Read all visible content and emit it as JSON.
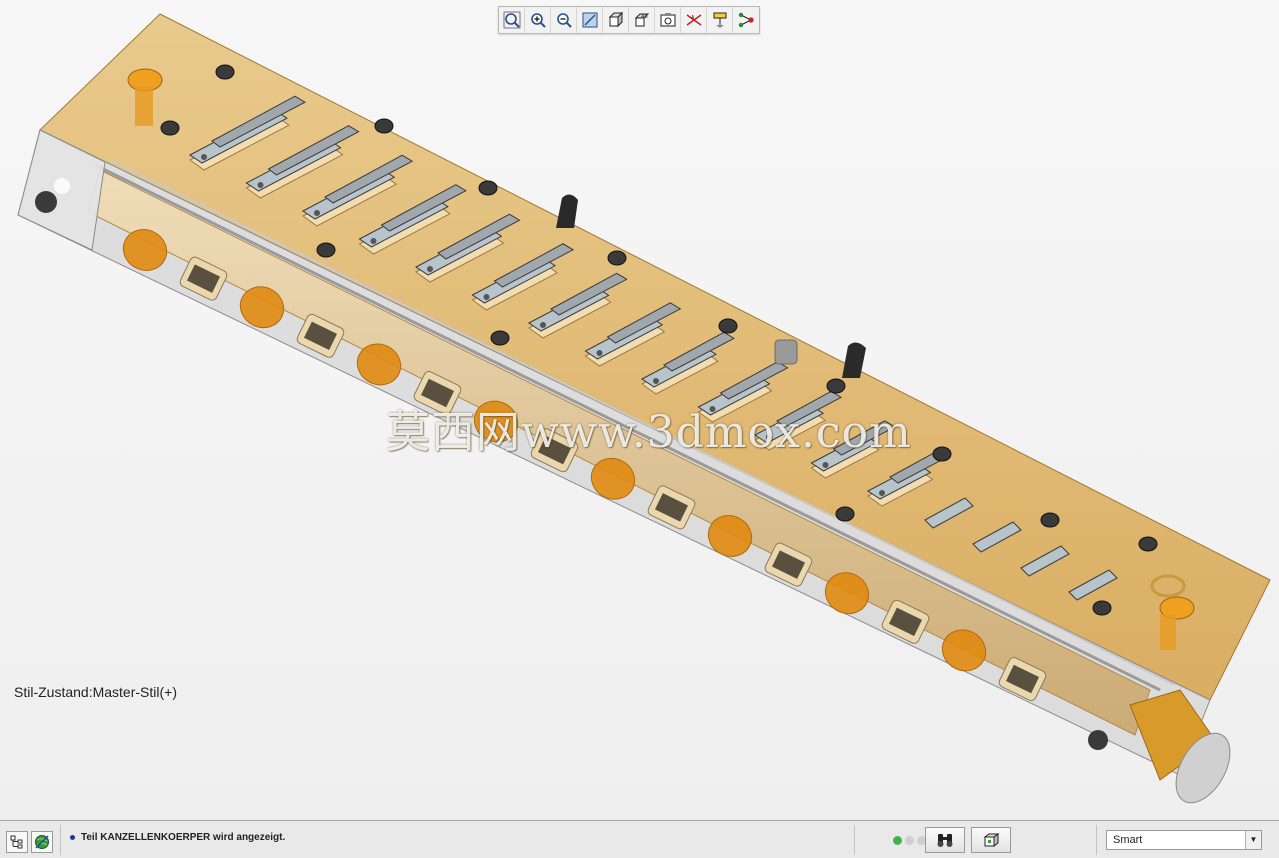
{
  "toolbar": {
    "buttons": [
      {
        "name": "zoom-fit-icon"
      },
      {
        "name": "zoom-in-icon"
      },
      {
        "name": "zoom-out-icon"
      },
      {
        "name": "repaint-icon"
      },
      {
        "name": "display-style-icon"
      },
      {
        "name": "saved-views-icon"
      },
      {
        "name": "view-manager-icon"
      },
      {
        "name": "datum-display-icon"
      },
      {
        "name": "annotation-display-icon"
      },
      {
        "name": "spin-center-icon"
      }
    ]
  },
  "watermark": {
    "text": "莫西网www.3dmox.com"
  },
  "viewport": {
    "style_state": "Stil-Zustand:Master-Stil(+)"
  },
  "status": {
    "message": "Teil KANZELLENKOERPER wird angezeigt.",
    "filter_value": "Smart",
    "filter_arrow": "▼"
  },
  "colors": {
    "body_fill": "#d9a94b",
    "orange_accent": "#e08a10",
    "reed_plate": "#b8c4cc",
    "status_green": "#3cb44a"
  }
}
